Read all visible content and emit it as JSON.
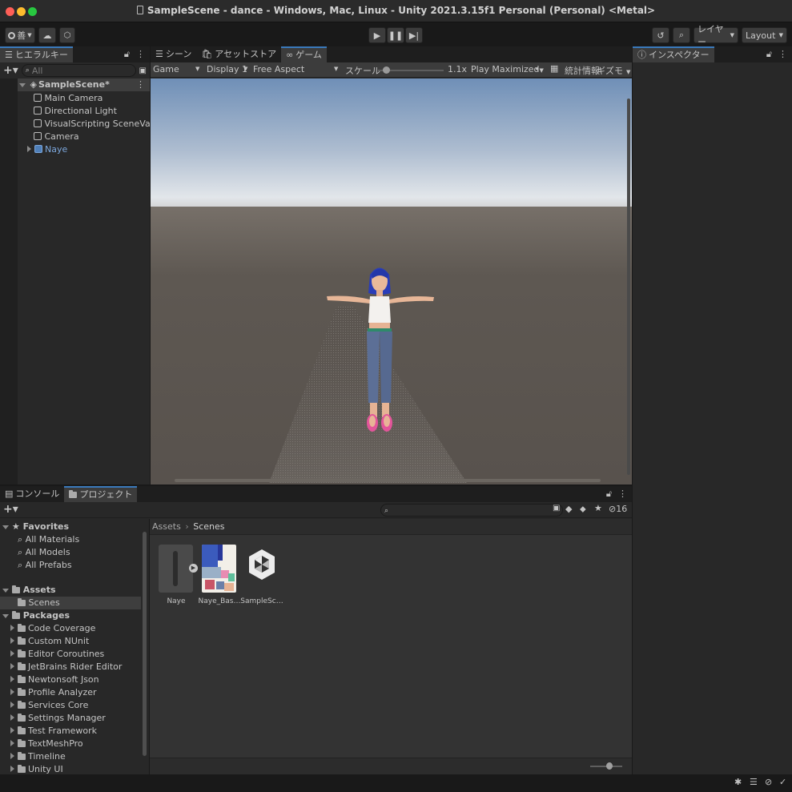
{
  "window": {
    "title": "SampleScene - dance - Windows, Mac, Linux - Unity 2021.3.15f1 Personal (Personal) <Metal>"
  },
  "colors": {
    "close": "#fe5f57",
    "minimize": "#febc2e",
    "zoom": "#28c840",
    "accent": "#3a79bb",
    "selected_object": "#7ca7dc"
  },
  "toolbar": {
    "account_label": "善",
    "layers_label": "レイヤー",
    "layout_label": "Layout"
  },
  "hierarchy": {
    "tab_label": "ヒエラルキー",
    "search_placeholder": "All",
    "scene_name": "SampleScene*",
    "items": [
      {
        "label": "Main Camera"
      },
      {
        "label": "Directional Light"
      },
      {
        "label": "VisualScripting SceneVariables"
      },
      {
        "label": "Camera"
      },
      {
        "label": "Naye"
      }
    ]
  },
  "center": {
    "tabs": [
      {
        "label": "シーン"
      },
      {
        "label": "アセットストア"
      },
      {
        "label": "ゲーム"
      }
    ],
    "game_toolbar": {
      "mode": "Game",
      "display": "Display 1",
      "aspect": "Free Aspect",
      "scale_label": "スケール",
      "scale_value": "1.1x",
      "play_mode": "Play Maximized",
      "stats_label": "統計情報",
      "gizmos_label": "ギズモ",
      "scale_fraction": 0.08
    }
  },
  "inspector": {
    "tab_label": "インスペクター"
  },
  "bottom": {
    "tabs": [
      {
        "label": "コンソール"
      },
      {
        "label": "プロジェクト"
      }
    ],
    "hidden_count": "16",
    "favorites": {
      "label": "Favorites",
      "items": [
        {
          "label": "All Materials"
        },
        {
          "label": "All Models"
        },
        {
          "label": "All Prefabs"
        }
      ]
    },
    "assets": {
      "label": "Assets",
      "items": [
        {
          "label": "Scenes"
        }
      ]
    },
    "packages": {
      "label": "Packages",
      "items": [
        {
          "label": "Code Coverage"
        },
        {
          "label": "Custom NUnit"
        },
        {
          "label": "Editor Coroutines"
        },
        {
          "label": "JetBrains Rider Editor"
        },
        {
          "label": "Newtonsoft Json"
        },
        {
          "label": "Profile Analyzer"
        },
        {
          "label": "Services Core"
        },
        {
          "label": "Settings Manager"
        },
        {
          "label": "Test Framework"
        },
        {
          "label": "TextMeshPro"
        },
        {
          "label": "Timeline"
        },
        {
          "label": "Unity UI"
        }
      ]
    },
    "breadcrumb": {
      "root": "Assets",
      "current": "Scenes"
    },
    "files": [
      {
        "label": "Naye",
        "icon": "prefab-icon"
      },
      {
        "label": "Naye_Bas…",
        "icon": "texture-thumbnail"
      },
      {
        "label": "SampleSc…",
        "icon": "unity-scene-icon"
      }
    ]
  }
}
